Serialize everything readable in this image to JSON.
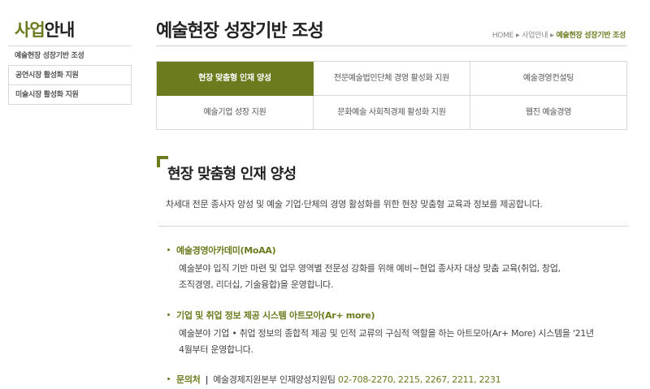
{
  "sidebar": {
    "title_accent": "사업",
    "title_rest": "안내",
    "items": [
      {
        "label": "예술현장 성장기반 조성"
      },
      {
        "label": "공연시장 활성화 지원"
      },
      {
        "label": "미술시장 활성화 지원"
      }
    ]
  },
  "header": {
    "title": "예술현장 성장기반 조성",
    "breadcrumb": {
      "home": "HOME",
      "sep_icon": "triangle-right-icon",
      "parent": "사업안내",
      "current": "예술현장 성장기반 조성"
    }
  },
  "tabs": [
    {
      "label": "현장 맞춤형 인재 양성",
      "active": true
    },
    {
      "label": "전문예술법인단체 경영 활성화 지원",
      "active": false
    },
    {
      "label": "예술경영컨설팅",
      "active": false
    },
    {
      "label": "예술기업 성장 지원",
      "active": false
    },
    {
      "label": "문화예술 사회적경제 활성화 지원",
      "active": false
    },
    {
      "label": "웹진 예술경영",
      "active": false
    }
  ],
  "section": {
    "title": "현장 맞춤형 인재 양성",
    "description": "차세대 전문 종사자 양성 및 예술 기업·단체의 경영 활성화를 위한 현장 맞춤형 교육과 정보를 제공합니다.",
    "items": [
      {
        "heading": "예술경영아카데미(MoAA)",
        "body_line1": "예술분야 입직 기반 마련 및 업무 영역별 전문성 강화를 위해 예비~현업 종사자 대상 맞춤 교육(취업, 창업,",
        "body_line2": "조직경영, 리더십, 기술융합)을 운영합니다."
      },
      {
        "heading": "기업 및 취업 정보 제공 시스템 아트모아(Ar+ more)",
        "body_line1": "예술분야 기업 • 취업 정보의 종합적 제공 및 인적 교류의 구심적 역할을 하는 아트모아(Ar+ More) 시스템을 '21년",
        "body_line2": "4월부터 운영합니다."
      }
    ],
    "contact": {
      "label": "문의처",
      "separator": "|",
      "department": "예술경제지원본부 인재양성지원팀",
      "phone": "02-708-2270, 2215, 2267, 2211, 2231"
    }
  },
  "colors": {
    "accent": "#6b7b1e",
    "border": "#d8d8d8",
    "text": "#333333"
  }
}
